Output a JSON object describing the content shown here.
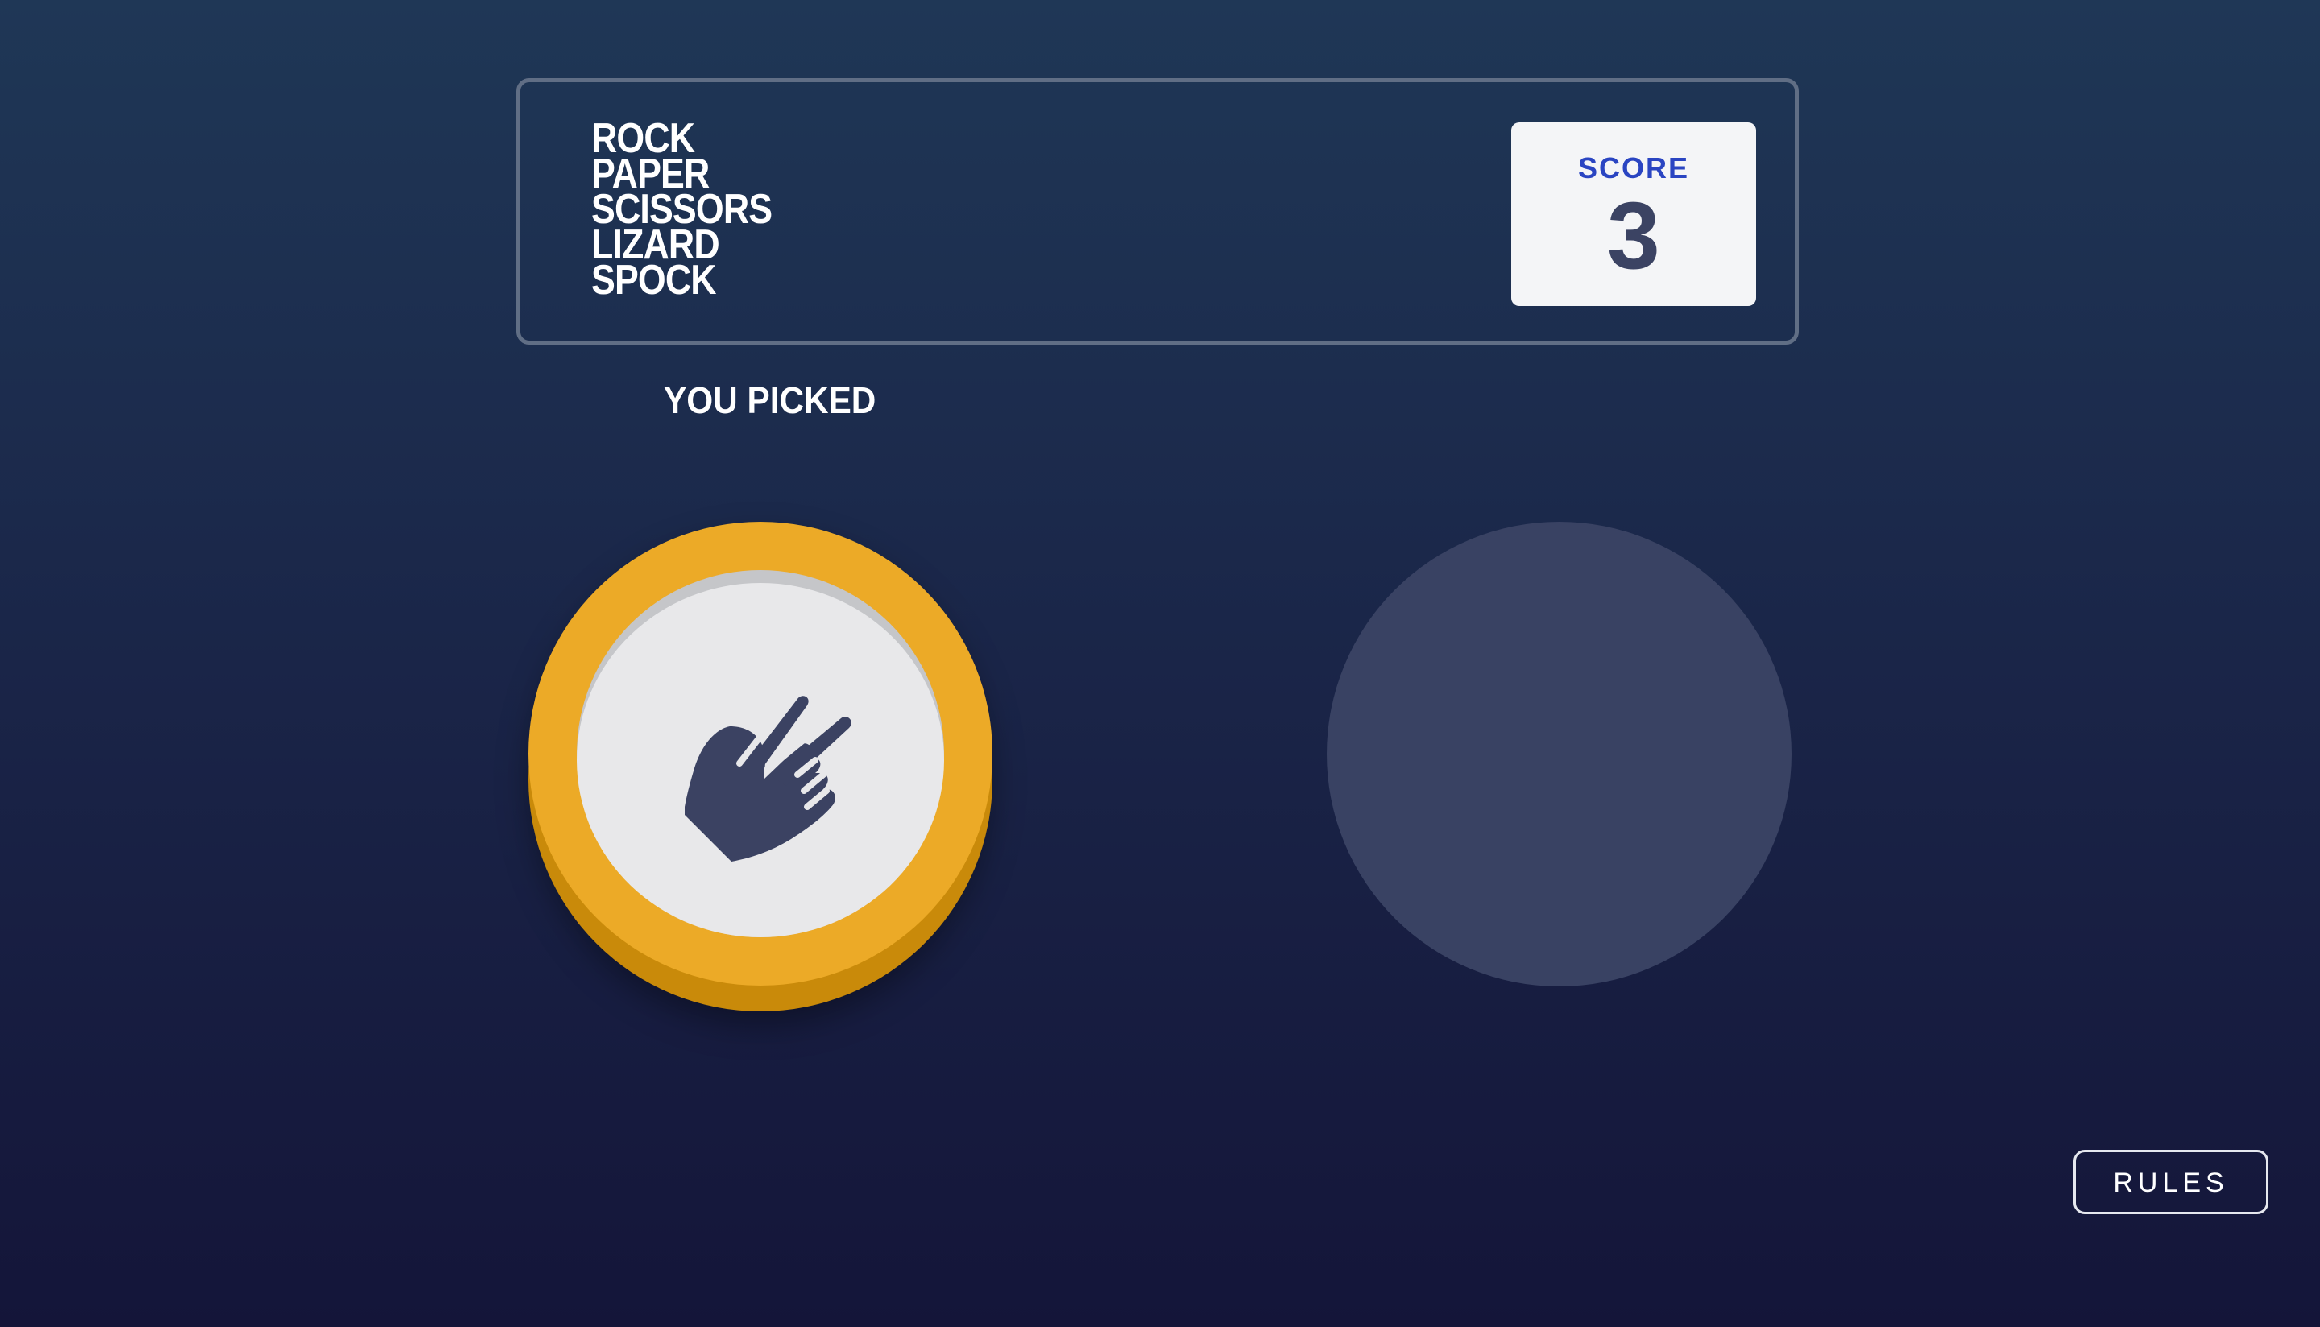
{
  "header": {
    "logo_lines": [
      "ROCK",
      "PAPER",
      "SCISSORS",
      "LIZARD",
      "SPOCK"
    ],
    "score_label": "SCORE",
    "score_value": "3"
  },
  "game": {
    "picked_label": "YOU PICKED",
    "player_choice": {
      "name": "scissors",
      "icon": "scissors-hand-icon",
      "ring_color": "#ecaa27",
      "ring_shadow_color": "#c98a0a"
    },
    "house_choice": {
      "state": "empty",
      "color": "#394263"
    }
  },
  "footer": {
    "rules_label": "RULES"
  },
  "colors": {
    "background_top": "#1f3756",
    "background_bottom": "#141539",
    "header_border": "#606e85",
    "score_label": "#2a45c2",
    "score_value": "#3b4363"
  }
}
